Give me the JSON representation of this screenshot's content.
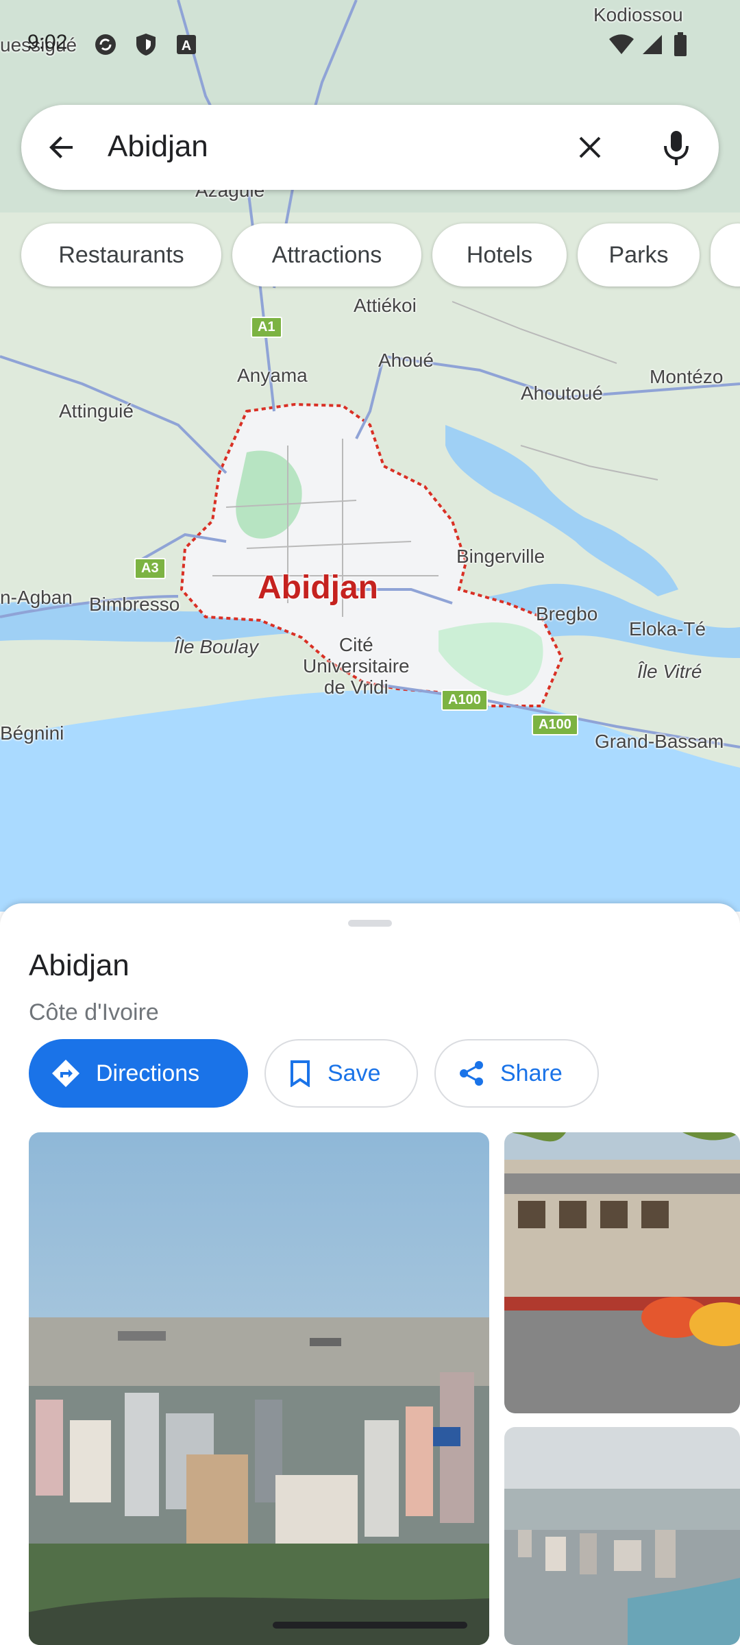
{
  "status_bar": {
    "time": "9:02"
  },
  "search": {
    "query": "Abidjan"
  },
  "chips": [
    "Restaurants",
    "Attractions",
    "Hotels",
    "Parks"
  ],
  "map": {
    "labels": {
      "kodiossou": "Kodiossou",
      "usseigue": "uessigué",
      "azaguie": "Azaguié",
      "attiekoi": "Attiékoi",
      "anyama": "Anyama",
      "ahoue": "Ahoué",
      "ahoutoue": "Ahoutoué",
      "montezo": "Montézo",
      "attingue": "Attinguié",
      "bingerville": "Bingerville",
      "abidjan": "Abidjan",
      "agban": "n-Agban",
      "bimbresso": "Bimbresso",
      "bregbo": "Bregbo",
      "eloka": "Eloka-Té",
      "boulay": "Île Boulay",
      "cite": "Cité\nUniversitaire\nde Vridi",
      "vitre": "Île Vitré",
      "begnini": "Bégnini",
      "bassam": "Grand-Bassam"
    },
    "roads": {
      "a1": "A1",
      "a3": "A3",
      "a100a": "A100",
      "a100b": "A100"
    }
  },
  "place": {
    "title": "Abidjan",
    "subtitle": "Côte d'Ivoire"
  },
  "actions": {
    "directions": "Directions",
    "save": "Save",
    "share": "Share"
  },
  "colors": {
    "accent": "#1a73e8",
    "city_boundary": "#d93025"
  }
}
